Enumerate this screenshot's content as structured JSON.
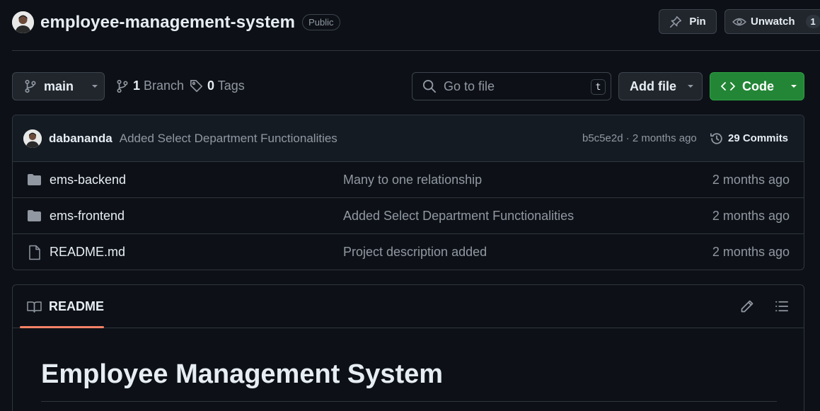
{
  "repo": {
    "name": "employee-management-system",
    "visibility": "Public",
    "pin_label": "Pin",
    "watch_label": "Unwatch",
    "watch_count": "1"
  },
  "toolbar": {
    "branch": "main",
    "branch_count": "1",
    "branch_label": "Branch",
    "tag_count": "0",
    "tag_label": "Tags",
    "search_placeholder": "Go to file",
    "search_shortcut": "t",
    "add_file_label": "Add file",
    "code_label": "Code"
  },
  "latest_commit": {
    "author": "dabananda",
    "message": "Added Select Department Functionalities",
    "hash_and_time": "b5c5e2d · 2 months ago",
    "commits_label": "29 Commits"
  },
  "files": [
    {
      "name": "ems-backend",
      "type": "folder",
      "commit": "Many to one relationship",
      "date": "2 months ago"
    },
    {
      "name": "ems-frontend",
      "type": "folder",
      "commit": "Added Select Department Functionalities",
      "date": "2 months ago"
    },
    {
      "name": "README.md",
      "type": "file",
      "commit": "Project description added",
      "date": "2 months ago"
    }
  ],
  "readme": {
    "tab_label": "README",
    "heading": "Employee Management System"
  },
  "colors": {
    "background": "#0d1117",
    "code_button": "#238636",
    "tab_underline": "#f78166",
    "muted_text": "#9198a1"
  },
  "icons": [
    "avatar",
    "pin-icon",
    "eye-icon",
    "branch-icon",
    "tag-icon",
    "search-icon",
    "chevron-down-icon",
    "code-brackets-icon",
    "history-icon",
    "folder-icon",
    "file-icon",
    "book-icon",
    "pencil-icon",
    "list-icon"
  ]
}
